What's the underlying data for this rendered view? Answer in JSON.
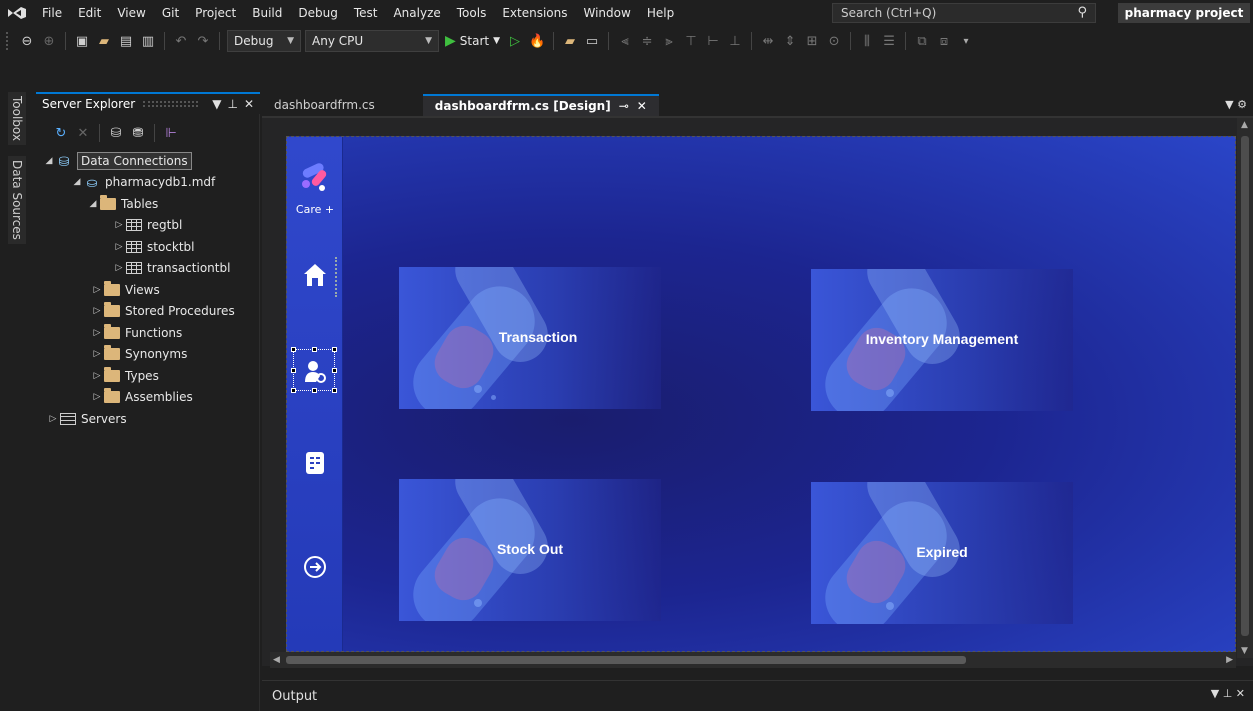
{
  "menubar": {
    "items": [
      "File",
      "Edit",
      "View",
      "Git",
      "Project",
      "Build",
      "Debug",
      "Test",
      "Analyze",
      "Tools",
      "Extensions",
      "Window",
      "Help"
    ],
    "search_placeholder": "Search (Ctrl+Q)",
    "project_name": "pharmacy project"
  },
  "toolbar": {
    "config": "Debug",
    "platform": "Any CPU",
    "start_label": "Start"
  },
  "left_strip": {
    "toolbox": "Toolbox",
    "data_sources": "Data Sources"
  },
  "server_explorer": {
    "title": "Server Explorer",
    "tree": {
      "data_connections": "Data Connections",
      "database": "pharmacydb1.mdf",
      "tables": "Tables",
      "table_items": [
        "regtbl",
        "stocktbl",
        "transactiontbl"
      ],
      "folders": [
        "Views",
        "Stored Procedures",
        "Functions",
        "Synonyms",
        "Types",
        "Assemblies"
      ],
      "servers": "Servers"
    }
  },
  "doc_tabs": {
    "tab1": "dashboardfrm.cs",
    "tab2": "dashboardfrm.cs [Design]"
  },
  "form": {
    "logo_label": "Care +",
    "cards": {
      "transaction": "Transaction",
      "inventory": "Inventory Management",
      "stock_out": "Stock Out",
      "expired": "Expired"
    }
  },
  "output": {
    "title": "Output"
  },
  "colors": {
    "accent": "#0078d4",
    "form_bg": "#1c2590",
    "sidebar": "#3048cc"
  }
}
